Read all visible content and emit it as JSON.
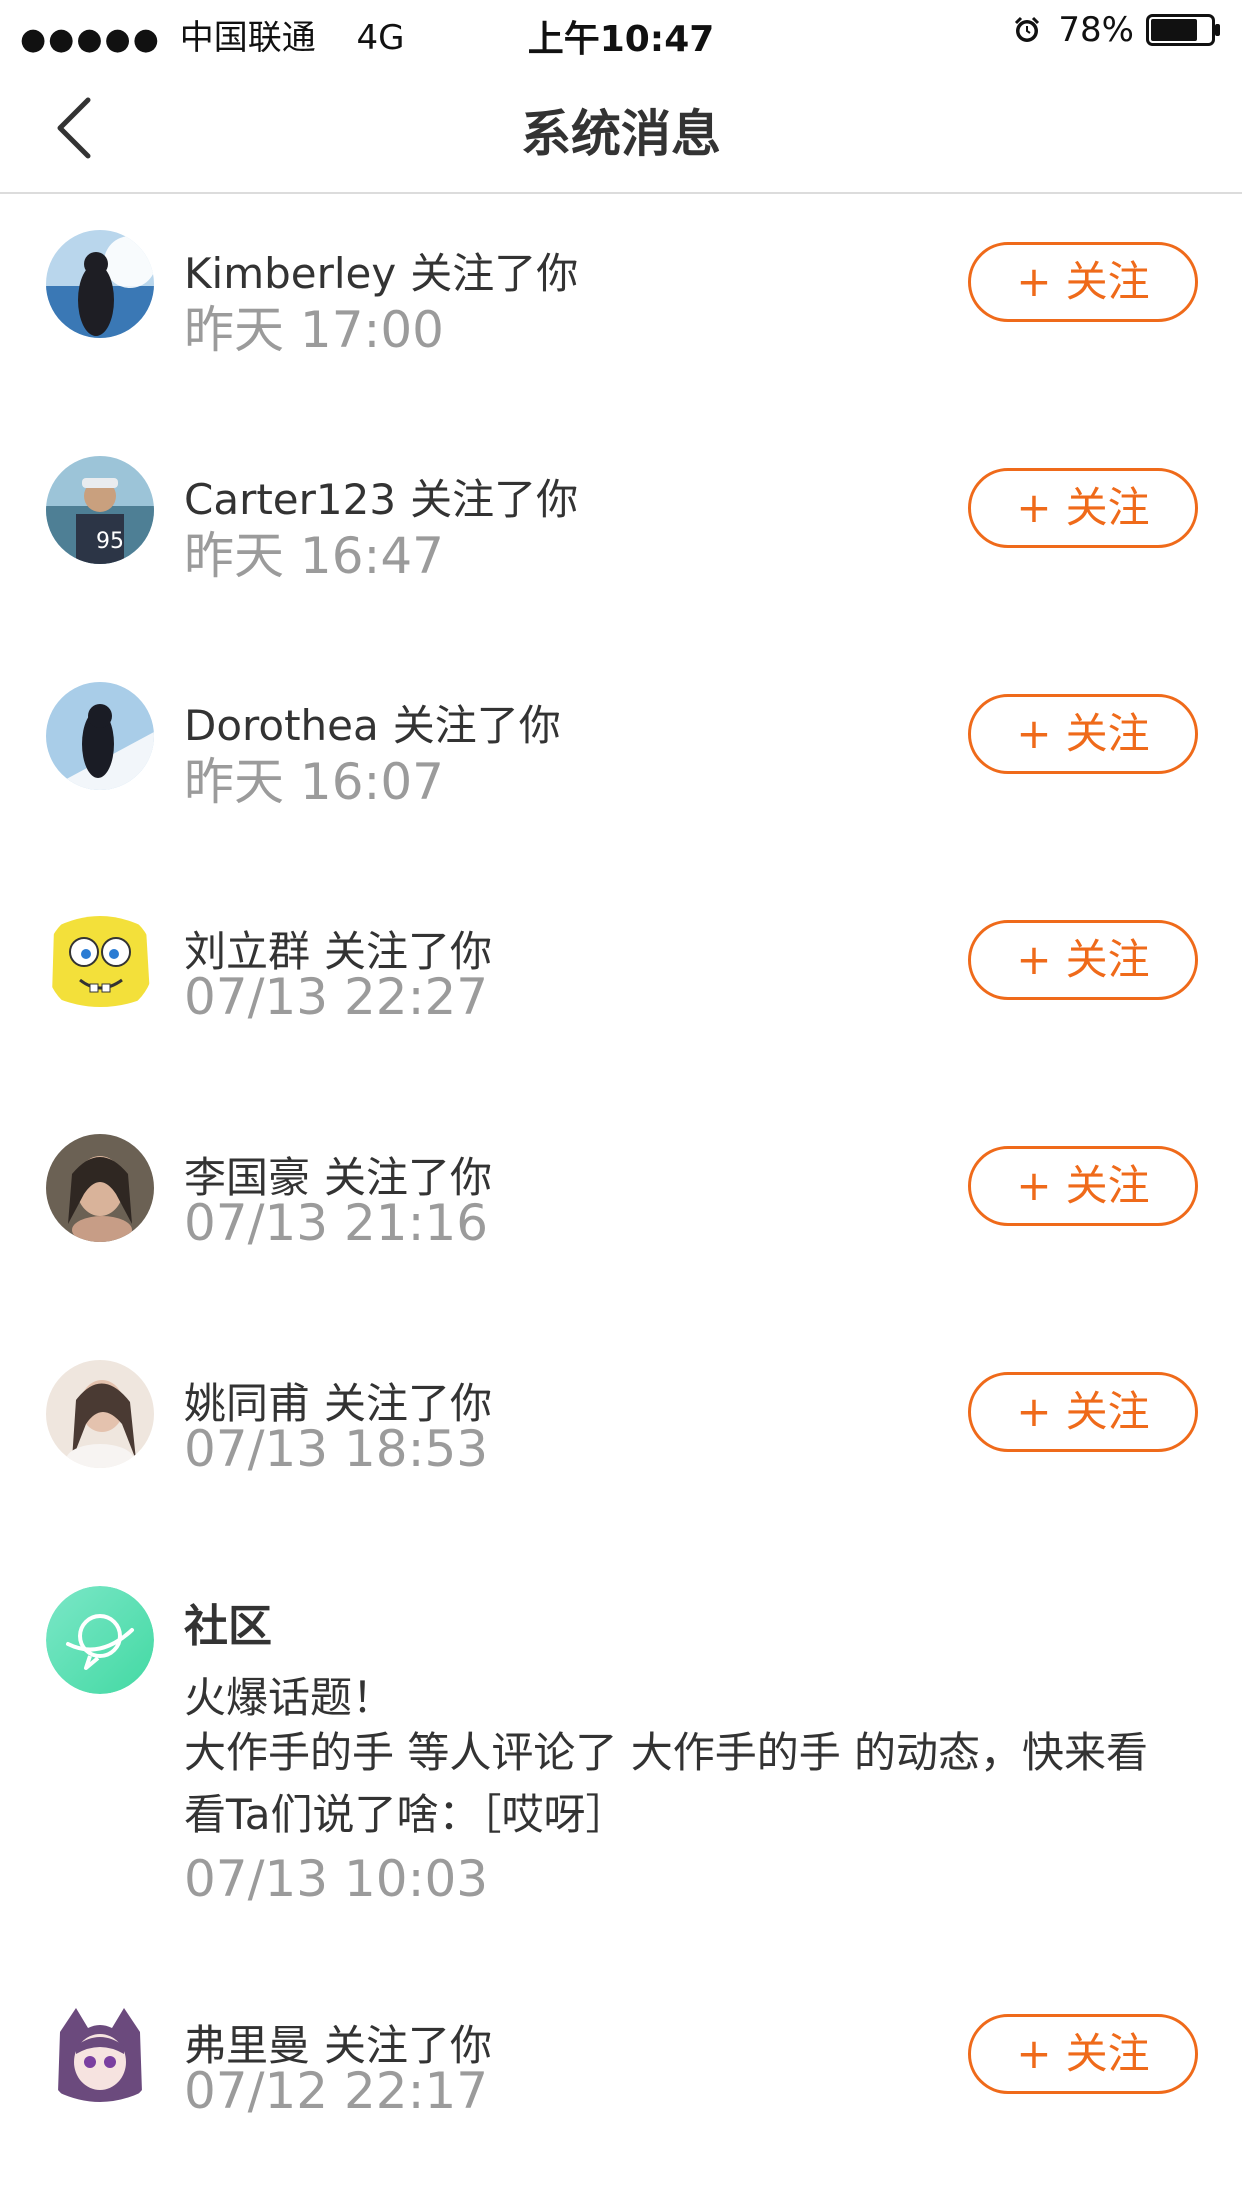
{
  "status_bar": {
    "signal_dots": "●●●●●",
    "carrier": "中国联通",
    "network": "4G",
    "time": "上午10:47",
    "battery_percent": "78%",
    "battery_level": 0.78
  },
  "nav": {
    "title": "系统消息",
    "back_icon": "chevron-left-icon"
  },
  "messages": [
    {
      "user": "Kimberley",
      "action": "关注了你",
      "time": "昨天 17:00",
      "button_plus": "+",
      "button_label": "关注"
    },
    {
      "user": "Carter123",
      "action": "关注了你",
      "time": "昨天 16:47",
      "button_plus": "+",
      "button_label": "关注"
    },
    {
      "user": "Dorothea",
      "action": "关注了你",
      "time": "昨天 16:07",
      "button_plus": "+",
      "button_label": "关注"
    },
    {
      "user": "刘立群",
      "action": "关注了你",
      "time": "07/13 22:27",
      "button_plus": "+",
      "button_label": "关注"
    },
    {
      "user": "李国豪",
      "action": "关注了你",
      "time": "07/13 21:16",
      "button_plus": "+",
      "button_label": "关注"
    },
    {
      "user": "姚同甫",
      "action": "关注了你",
      "time": "07/13 18:53",
      "button_plus": "+",
      "button_label": "关注"
    },
    {
      "user": "弗里曼",
      "action": "关注了你",
      "time": "07/12 22:17",
      "button_plus": "+",
      "button_label": "关注"
    }
  ],
  "community": {
    "title": "社区",
    "subtitle": "火爆话题！",
    "body": " 大作手的手 等人评论了 大作手的手 的动态，快来看看Ta们说了啥：［哎呀］",
    "time": "07/13 10:03",
    "icon": "planet-chat-icon"
  },
  "colors": {
    "accent": "#ef6a1a",
    "time_text": "#9b9b9b",
    "community_icon": "#5ee0b0"
  }
}
